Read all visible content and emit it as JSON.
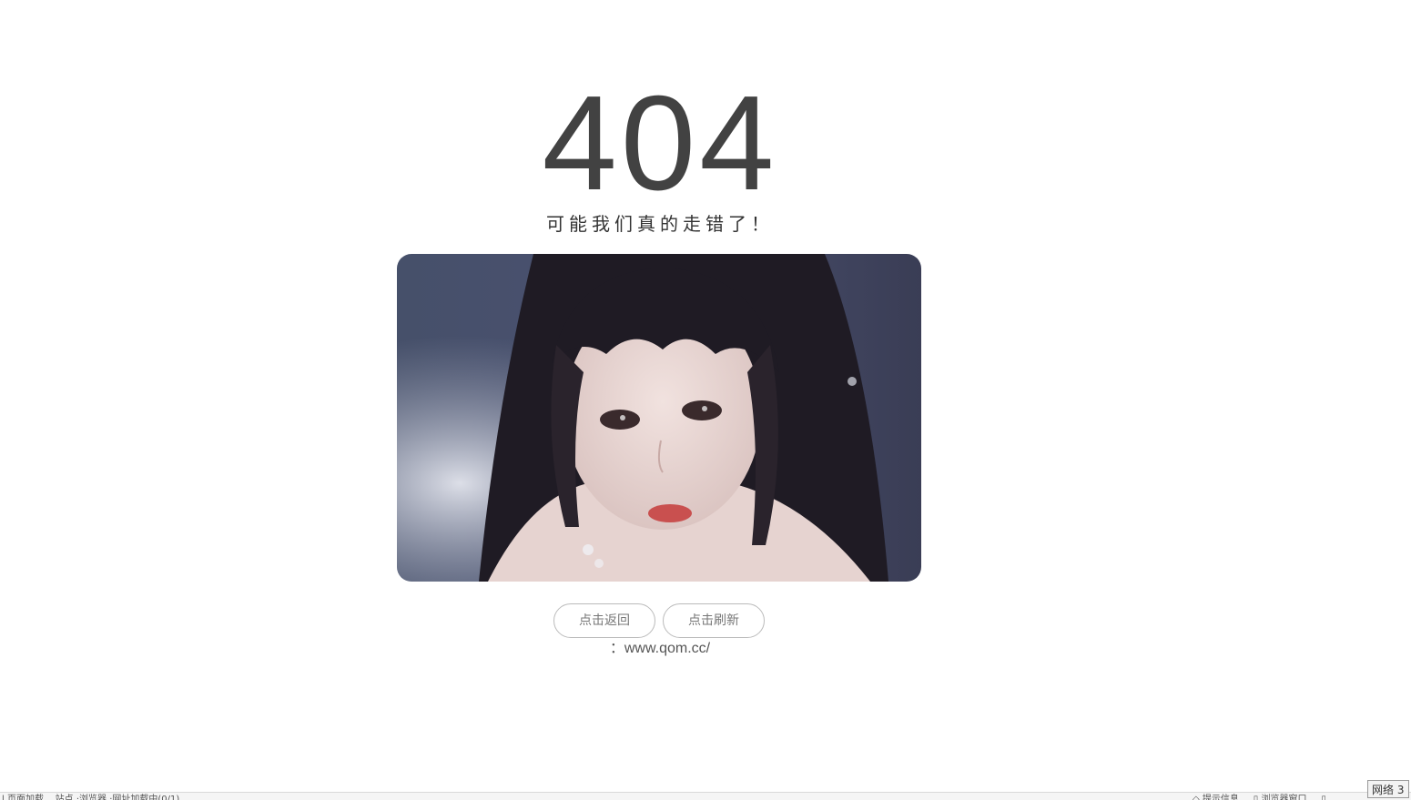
{
  "error": {
    "code": "404",
    "message": "可能我们真的走错了！"
  },
  "image": {
    "alt": "portrait photo",
    "colors": {
      "background_dark": "#3b4259",
      "background_light": "#c9ccd6",
      "hair": "#1f1b24",
      "skin": "#e9d6d2",
      "lips": "#c9504f"
    }
  },
  "actions": {
    "back_label": "点击返回",
    "refresh_label": "点击刷新"
  },
  "site": {
    "url": "：www.qom.cc/"
  },
  "status_bar": {
    "left_text": "l 页面加载...  站点 ·浏览器 ·网址加载中(0/1)",
    "right_text": "◇ 提示信息 ...   ▯ 浏览器窗口 ...   ▯",
    "network_label": "网络",
    "network_count": "3"
  },
  "colors": {
    "code_text": "#424242",
    "button_border": "#bbbbbb",
    "button_text": "#777777"
  }
}
